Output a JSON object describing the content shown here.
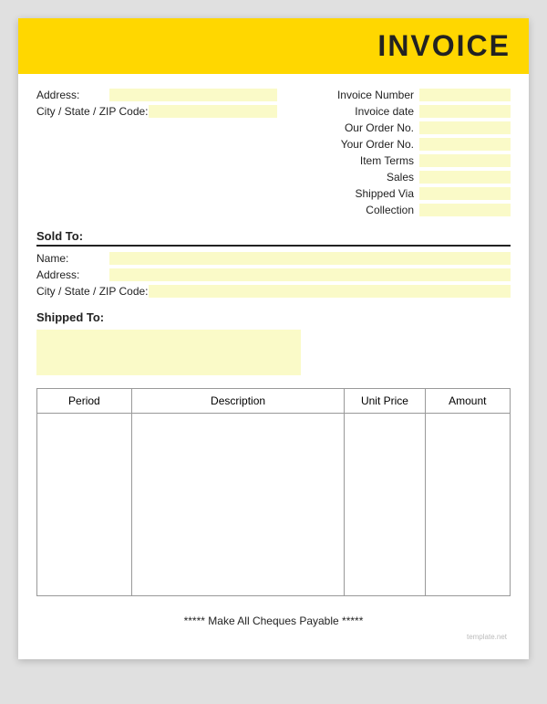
{
  "header": {
    "title": "INVOICE",
    "bg_color": "#FFD700"
  },
  "left_address": {
    "address_label": "Address:",
    "city_label": "City / State / ZIP Code:"
  },
  "right_fields": [
    {
      "label": "Invoice Number"
    },
    {
      "label": "Invoice date"
    },
    {
      "label": "Our Order No."
    },
    {
      "label": "Your Order No."
    },
    {
      "label": "Item Terms"
    },
    {
      "label": "Sales"
    },
    {
      "label": "Shipped Via"
    },
    {
      "label": "Collection"
    }
  ],
  "sold_to": {
    "label": "Sold To:",
    "name_label": "Name:",
    "address_label": "Address:",
    "city_label": "City / State / ZIP Code:"
  },
  "shipped_to": {
    "label": "Shipped To:"
  },
  "table": {
    "columns": [
      "Period",
      "Description",
      "Unit Price",
      "Amount"
    ]
  },
  "footer": {
    "text": "***** Make All Cheques Payable *****"
  },
  "watermark": "template.net"
}
